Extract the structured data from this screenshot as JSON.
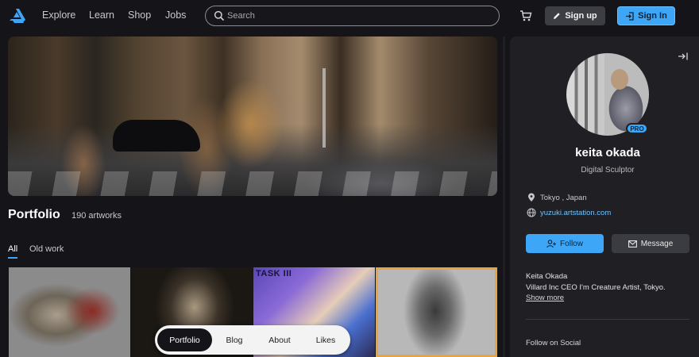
{
  "header": {
    "nav": [
      "Explore",
      "Learn",
      "Shop",
      "Jobs"
    ],
    "search_placeholder": "Search",
    "signup_label": "Sign up",
    "signin_label": "Sign In",
    "icons": [
      "artstation-logo-icon",
      "search-icon",
      "cart-icon",
      "pencil-icon",
      "sign-in-icon"
    ]
  },
  "portfolio": {
    "title": "Portfolio",
    "count": "190 artworks",
    "tabs": [
      "All",
      "Old work"
    ],
    "active_tab": "All",
    "thumb3_label": "TASK III"
  },
  "bottom_nav": {
    "items": [
      "Portfolio",
      "Blog",
      "About",
      "Likes"
    ],
    "active": "Portfolio"
  },
  "profile": {
    "badge": "PRO",
    "name": "keita okada",
    "role": "Digital Sculptor",
    "location": "Tokyo , Japan",
    "website": "yuzuki.artstation.com",
    "follow_label": "Follow",
    "message_label": "Message",
    "bio_name": "Keita Okada",
    "bio_text": "Villard Inc CEO I'm Creature Artist, Tokyo.",
    "show_more": "Show more",
    "social_heading": "Follow on Social"
  },
  "colors": {
    "accent": "#3ea6f7",
    "background": "#141419",
    "panel": "#202024"
  }
}
